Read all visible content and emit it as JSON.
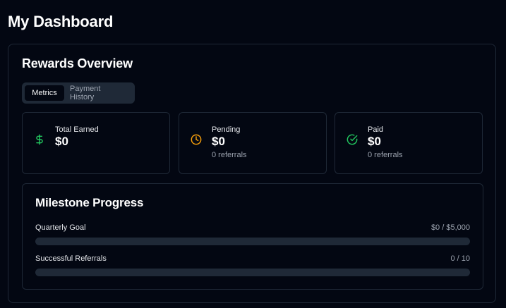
{
  "page": {
    "title": "My Dashboard"
  },
  "rewards": {
    "title": "Rewards Overview",
    "tabs": [
      {
        "label": "Metrics",
        "active": true
      },
      {
        "label": "Payment History",
        "active": false
      }
    ],
    "stats": [
      {
        "label": "Total Earned",
        "value": "$0",
        "sub": "",
        "icon": "dollar-icon",
        "icon_color": "#22c55e"
      },
      {
        "label": "Pending",
        "value": "$0",
        "sub": "0 referrals",
        "icon": "clock-icon",
        "icon_color": "#f59e0b"
      },
      {
        "label": "Paid",
        "value": "$0",
        "sub": "0 referrals",
        "icon": "check-circle-icon",
        "icon_color": "#22c55e"
      }
    ]
  },
  "milestones": {
    "title": "Milestone Progress",
    "items": [
      {
        "label": "Quarterly Goal",
        "value": "$0 / $5,000",
        "progress": 0
      },
      {
        "label": "Successful Referrals",
        "value": "0 / 10",
        "progress": 0
      }
    ]
  }
}
